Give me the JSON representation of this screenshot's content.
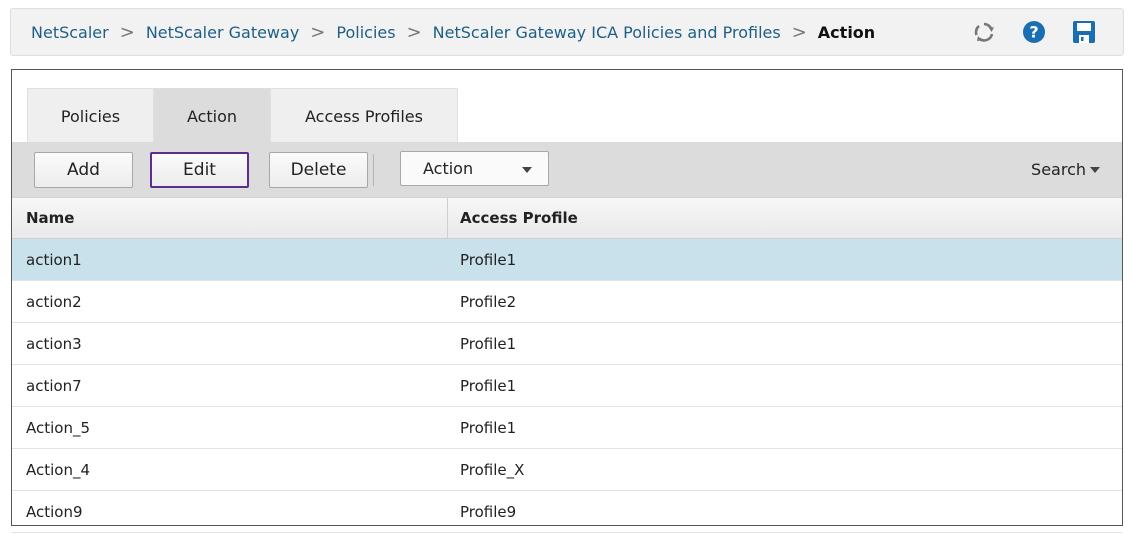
{
  "breadcrumb": [
    {
      "label": "NetScaler",
      "current": false
    },
    {
      "label": "NetScaler Gateway",
      "current": false
    },
    {
      "label": "Policies",
      "current": false
    },
    {
      "label": "NetScaler Gateway ICA Policies and Profiles",
      "current": false
    },
    {
      "label": "Action",
      "current": true
    }
  ],
  "breadcrumb_separator": ">",
  "toolbar_icons": {
    "refresh": "refresh-icon",
    "help": "help-icon",
    "save": "save-icon"
  },
  "colors": {
    "help_icon": "#1a6fb3",
    "save_icon": "#1a6fb3",
    "link": "#1f5f86",
    "selected_row": "#c9e1ea",
    "edit_focus": "#5b2d8e"
  },
  "tabs": [
    {
      "label": "Policies",
      "active": false
    },
    {
      "label": "Action",
      "active": true
    },
    {
      "label": "Access Profiles",
      "active": false
    }
  ],
  "actions": {
    "add_label": "Add",
    "edit_label": "Edit",
    "delete_label": "Delete",
    "select_value": "Action",
    "search_label": "Search"
  },
  "table": {
    "columns": [
      "Name",
      "Access Profile"
    ],
    "rows": [
      {
        "name": "action1",
        "profile": "Profile1",
        "selected": true
      },
      {
        "name": "action2",
        "profile": "Profile2",
        "selected": false
      },
      {
        "name": "action3",
        "profile": "Profile1",
        "selected": false
      },
      {
        "name": "action7",
        "profile": "Profile1",
        "selected": false
      },
      {
        "name": "Action_5",
        "profile": "Profile1",
        "selected": false
      },
      {
        "name": "Action_4",
        "profile": "Profile_X",
        "selected": false
      },
      {
        "name": "Action9",
        "profile": "Profile9",
        "selected": false
      }
    ]
  }
}
